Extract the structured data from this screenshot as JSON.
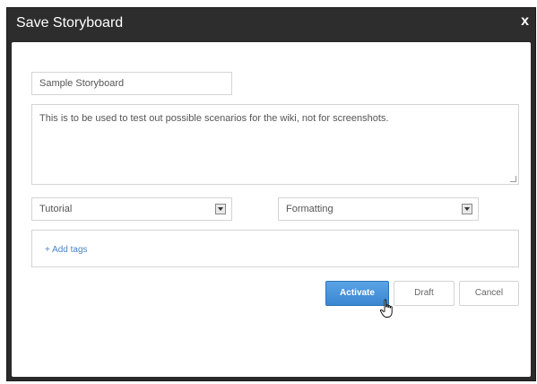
{
  "dialog": {
    "title": "Save Storyboard",
    "close_label": "x"
  },
  "form": {
    "name_value": "Sample Storyboard",
    "description_value": "This is to be used to test out possible scenarios for the wiki, not for screenshots.",
    "category_selected": "Tutorial",
    "subcategory_selected": "Formatting",
    "add_tags_label": "+ Add tags"
  },
  "buttons": {
    "activate_label": "Activate",
    "draft_label": "Draft",
    "cancel_label": "Cancel"
  },
  "colors": {
    "titlebar": "#2d2d2d",
    "accent": "#3a86d1",
    "link": "#4a86c5"
  },
  "icons": {
    "cursor": "hand-pointer-icon",
    "select_arrow": "chevron-down-icon",
    "resize": "resize-grip-icon"
  }
}
